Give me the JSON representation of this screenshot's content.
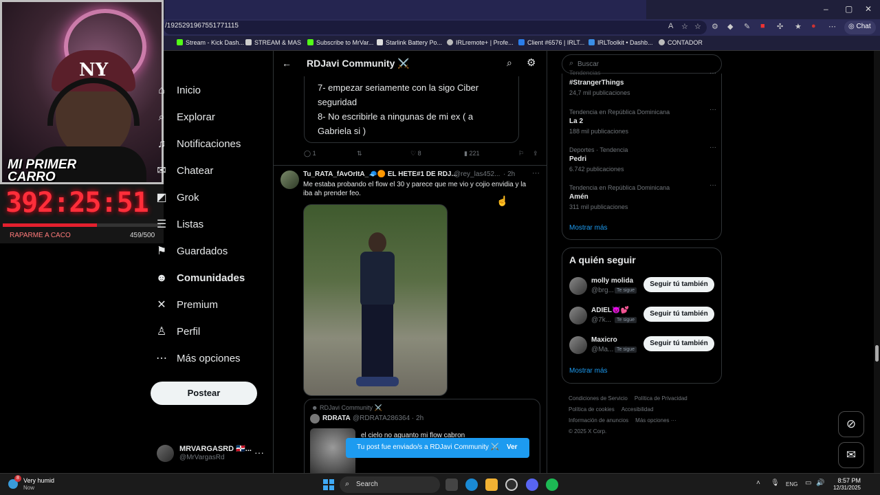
{
  "browser": {
    "url": "/1925291967551771115",
    "chat_label": "Chat",
    "window_controls": [
      "–",
      "▢",
      "✕"
    ],
    "bookmarks": [
      {
        "label": "Stream - Kick Dash...",
        "color": "#53fc18"
      },
      {
        "label": "STREAM & MAS",
        "color": "#cccccc"
      },
      {
        "label": "Subscribe to MrVar...",
        "color": "#53fc18"
      },
      {
        "label": "Starlink Battery Po...",
        "color": "#dddddd"
      },
      {
        "label": "IRLremote+ | Profe...",
        "color": "#bbbbbb"
      },
      {
        "label": "Client #6576 | IRLT...",
        "color": "#2b7de9"
      },
      {
        "label": "IRLToolkit • Dashb...",
        "color": "#3a8ee6"
      },
      {
        "label": "CONTADOR",
        "color": "#bbbbbb"
      }
    ]
  },
  "overlay": {
    "cap_logo": "NY",
    "banner": "MI PRIMER CARRO",
    "timer": "392:25:51",
    "goal_label": "RAPARME A CACO",
    "goal_count": "459/500",
    "goal_fraction": 0.596
  },
  "nav": {
    "items": [
      {
        "label": "Inicio",
        "icon": "home-icon",
        "glyph": "⌂",
        "bold": false
      },
      {
        "label": "Explorar",
        "icon": "search-icon",
        "glyph": "⌕",
        "bold": false
      },
      {
        "label": "Notificaciones",
        "icon": "bell-icon",
        "glyph": "♫",
        "bold": false
      },
      {
        "label": "Chatear",
        "icon": "chat-icon",
        "glyph": "✉",
        "bold": false
      },
      {
        "label": "Grok",
        "icon": "grok-icon",
        "glyph": "◩",
        "bold": false
      },
      {
        "label": "Listas",
        "icon": "list-icon",
        "glyph": "☰",
        "bold": false
      },
      {
        "label": "Guardados",
        "icon": "bookmark-icon",
        "glyph": "⚑",
        "bold": false
      },
      {
        "label": "Comunidades",
        "icon": "communities-icon",
        "glyph": "☻",
        "bold": true
      },
      {
        "label": "Premium",
        "icon": "x-logo-icon",
        "glyph": "✕",
        "bold": false
      },
      {
        "label": "Perfil",
        "icon": "person-icon",
        "glyph": "♙",
        "bold": false
      },
      {
        "label": "Más opciones",
        "icon": "more-circle-icon",
        "glyph": "⋯",
        "bold": false
      }
    ],
    "post_button": "Postear",
    "account": {
      "name": "MRVARGASRD 🇩🇴...",
      "handle": "@MrVargasRd",
      "more": "···"
    }
  },
  "center": {
    "title": "RDJavi Community ⚔️",
    "quote1_text": "7- empezar seriamente con la sigo Ciber\nseguridad\n8- No escribirle a ningunas de mi ex ( a\nGabriela si )",
    "actions": {
      "replies": "1",
      "reposts": "",
      "likes": "8",
      "views": "221"
    },
    "tweet": {
      "name": "Tu_RATA_fAvOrItA_🧢🟠 EL HETE#1 DE RDJ...",
      "handle": "@rey_las452...",
      "time": "· 2h",
      "text": "Me estaba probando el flow el 30 y parece que me vio y cojio envidia y la iba ah prender feo."
    },
    "quoted": {
      "community": "RDJavi Community ⚔️",
      "name": "RDRATA",
      "handle": "@RDRATA286364 · 2h",
      "text": "el cielo no aguanto mi flow cabron"
    },
    "toast": {
      "text": "Tu post fue enviado/s a RDJavi Community ⚔️",
      "link": "Ver"
    }
  },
  "right": {
    "search_placeholder": "Buscar",
    "trends": [
      {
        "context": "Tendencias",
        "name": "#StrangerThings",
        "count": "24,7 mil publicaciones"
      },
      {
        "context": "Tendencia en República Dominicana",
        "name": "La 2",
        "count": "188 mil publicaciones"
      },
      {
        "context": "Deportes · Tendencia",
        "name": "Pedri",
        "count": "6.742 publicaciones"
      },
      {
        "context": "Tendencia en República Dominicana",
        "name": "Amén",
        "count": "311 mil publicaciones"
      }
    ],
    "show_more": "Mostrar más",
    "who_to_follow": {
      "title": "A quién seguir",
      "users": [
        {
          "name": "molly molida",
          "handle": "@brg...",
          "badge": "Te sigue",
          "button": "Seguir tú también"
        },
        {
          "name": "ADIEL😈💕",
          "handle": "@7k...",
          "badge": "Te sigue",
          "button": "Seguir tú también"
        },
        {
          "name": "Maxicro",
          "handle": "@Ma...",
          "badge": "Te sigue",
          "button": "Seguir tú también"
        }
      ],
      "show_more": "Mostrar más"
    },
    "footer": [
      "Condiciones de Servicio",
      "Política de Privacidad",
      "Política de cookies",
      "Accesibilidad",
      "Información de anuncios",
      "Más opciones ···",
      "© 2025 X Corp."
    ]
  },
  "taskbar": {
    "weather_title": "Very humid",
    "weather_sub": "Now",
    "weather_badge": "8",
    "search_label": "Search",
    "lang": "ENG",
    "time": "8:57 PM",
    "date": "12/31/2025"
  }
}
